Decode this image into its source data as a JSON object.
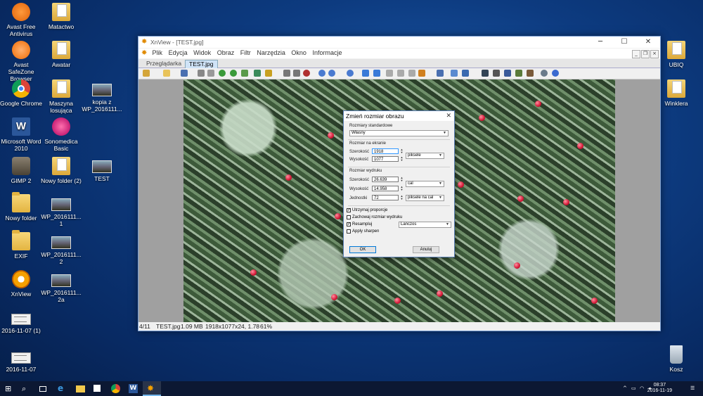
{
  "desktop": {
    "icons": [
      {
        "label": "Avast Free Antivirus",
        "icon": "avast-icon"
      },
      {
        "label": "Avast SafeZone Browser",
        "icon": "avast-safezone-icon"
      },
      {
        "label": "Google Chrome",
        "icon": "chrome-icon"
      },
      {
        "label": "Microsoft Word 2010",
        "icon": "word-icon"
      },
      {
        "label": "GIMP 2",
        "icon": "gimp-icon"
      },
      {
        "label": "Nowy folder",
        "icon": "folder-icon"
      },
      {
        "label": "EXIF",
        "icon": "folder-icon"
      },
      {
        "label": "XnView",
        "icon": "xnview-icon"
      },
      {
        "label": "2016-11-07 (1)",
        "icon": "image-icon"
      },
      {
        "label": "2016-11-07",
        "icon": "image-icon"
      },
      {
        "label": "Matactwo",
        "icon": "folder-icon"
      },
      {
        "label": "Awatar",
        "icon": "folder-icon"
      },
      {
        "label": "Maszyna losująca",
        "icon": "folder-icon"
      },
      {
        "label": "Sonomedica Basic",
        "icon": "sonomedica-icon"
      },
      {
        "label": "Nowy folder (2)",
        "icon": "folder-icon"
      },
      {
        "label": "WP_2016111... 1",
        "icon": "photo-icon"
      },
      {
        "label": "WP_2016111... 2",
        "icon": "photo-icon"
      },
      {
        "label": "WP_2016111... 2a",
        "icon": "photo-icon"
      },
      {
        "label": "kopia z WP_2016111...",
        "icon": "photo-icon"
      },
      {
        "label": "TEST",
        "icon": "photo-icon"
      },
      {
        "label": "UBIQ",
        "icon": "folder-icon"
      },
      {
        "label": "Winklera",
        "icon": "folder-icon"
      },
      {
        "label": "Kosz",
        "icon": "recycle-bin-icon"
      }
    ]
  },
  "window": {
    "title": "XnView - [TEST.jpg]",
    "menu": [
      "Plik",
      "Edycja",
      "Widok",
      "Obraz",
      "Filtr",
      "Narzędzia",
      "Okno",
      "Informacje"
    ],
    "tabs": [
      "Przeglądarka",
      "TEST.jpg"
    ],
    "status": {
      "index": "4/11",
      "file": "TEST.jpg",
      "size": "1.09 MB",
      "info": "1918x1077x24, 1.78",
      "zoom": "61%"
    }
  },
  "dialog": {
    "title": "Zmień rozmiar obrazu",
    "group_standard": "Rozmiary standardowe",
    "standard_value": "Własny",
    "group_screen": "Rozmiar na ekranie",
    "width_label": "Szerokość",
    "height_label": "Wysokość",
    "screen_width": "1918",
    "screen_height": "1077",
    "screen_unit": "piksele",
    "group_print": "Rozmiar wydruku",
    "print_width": "26.639",
    "print_height": "14.958",
    "print_unit": "cal",
    "units_label": "Jednostki",
    "units_value": "72",
    "units_unit": "piksele na cal",
    "keep_ratio": "Utrzymaj proporcje",
    "keep_print": "Zachowaj rozmiar wydruku",
    "resample": "Resampluj",
    "resample_method": "Lanczos",
    "sharpen": "Apply sharpen",
    "ok": "OK",
    "cancel": "Anuluj",
    "checks": {
      "keep_ratio": true,
      "keep_print": false,
      "resample": true,
      "sharpen": false
    }
  },
  "taskbar": {
    "time": "08:37",
    "date": "2016-11-19"
  }
}
